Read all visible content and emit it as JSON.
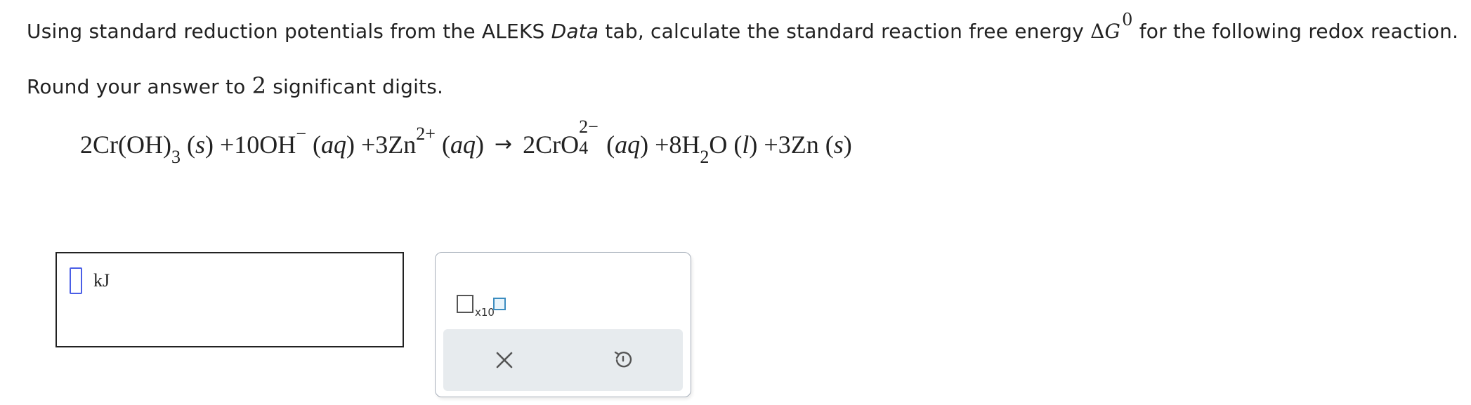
{
  "question": {
    "line1_part1": "Using standard reduction potentials from the ALEKS ",
    "line1_italic": "Data",
    "line1_part2": " tab, calculate the standard reaction free energy ",
    "delta_symbol": "Δ",
    "g_symbol": "G",
    "g_superscript": "0",
    "line1_part3": " for the following redox reaction.",
    "line2_part1": "Round your answer to ",
    "sig_figs": "2",
    "line2_part2": " significant digits."
  },
  "equation": {
    "t1": "2Cr",
    "t2": "(OH)",
    "t2_sub": "3",
    "t3_state": "s",
    "t4": "+10OH",
    "t4_sup": "−",
    "t5_state": "aq",
    "t6": "+3Zn",
    "t6_sup": "2+",
    "t7_state": "aq",
    "arrow": "→",
    "t8": "2CrO",
    "t8_sup": "2−",
    "t8_sub": "4",
    "t9_state": "aq",
    "t10": "+8H",
    "t10_sub": "2",
    "t10b": "O",
    "t11_state": "l",
    "t12": "+3Zn",
    "t13_state": "s"
  },
  "answer": {
    "value": "",
    "unit": "kJ"
  },
  "palette": {
    "sci_notation_label": "x10",
    "clear_icon": "close-icon",
    "undo_icon": "undo-icon"
  },
  "colors": {
    "input_border": "#4a5ee6",
    "exponent_box": "#3c8dc0",
    "palette_action_bg": "#e7ebee"
  }
}
